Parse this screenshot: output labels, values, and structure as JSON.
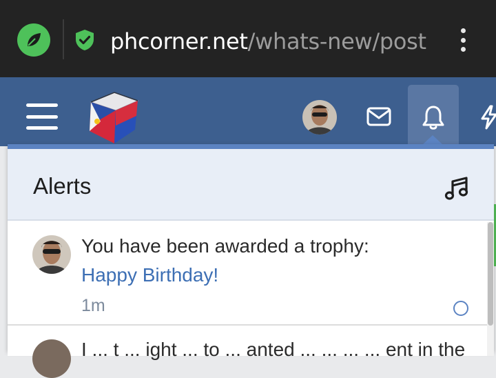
{
  "browser": {
    "url_host": "phcorner.net",
    "url_path": "/whats-new/post",
    "site_icon": "leaf-icon",
    "security_icon": "shield-check-icon",
    "menu_icon": "kebab-menu-icon"
  },
  "header": {
    "menu_icon": "hamburger-icon",
    "logo": "phcorner-cube-logo",
    "icons": [
      "avatar",
      "mail-icon",
      "bell-icon",
      "bolt-icon"
    ],
    "colors": {
      "bar": "#3d5f8f",
      "active_tab": "#5a77a3"
    }
  },
  "alerts_panel": {
    "title": "Alerts",
    "sound_icon": "music-note-icon",
    "accent": "#5b83c2",
    "items": [
      {
        "text": "You have been awarded a trophy:",
        "link": "Happy Birthday!",
        "time": "1m"
      },
      {
        "text": "I ... t ... ight ... to ... anted ... ... ... ... ent in the"
      }
    ]
  }
}
